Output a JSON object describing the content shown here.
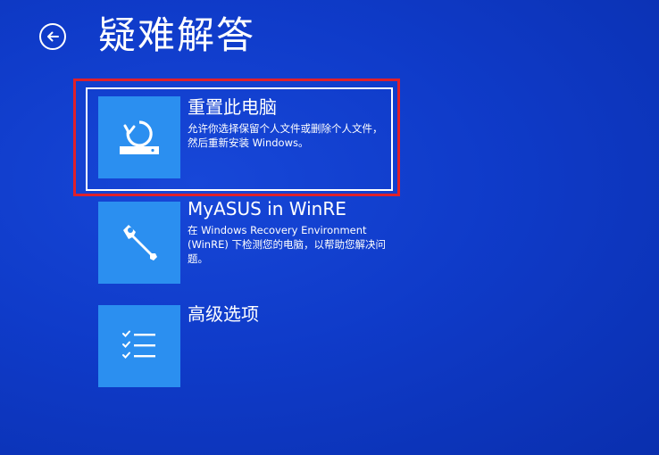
{
  "header": {
    "title": "疑难解答",
    "back_label": "返回"
  },
  "options": [
    {
      "title": "重置此电脑",
      "description": "允许你选择保留个人文件或删除个人文件，然后重新安装 Windows。",
      "icon": "reset-pc-icon",
      "selected": true
    },
    {
      "title": "MyASUS in WinRE",
      "description": "在 Windows Recovery Environment (WinRE) 下检测您的电脑，以帮助您解决问题。",
      "icon": "wrench-icon",
      "selected": false
    },
    {
      "title": "高级选项",
      "description": "",
      "icon": "checklist-icon",
      "selected": false
    }
  ],
  "colors": {
    "background": "#0f3bc9",
    "tile": "#2b8ff0",
    "highlight": "#e0202a",
    "text": "#ffffff"
  }
}
